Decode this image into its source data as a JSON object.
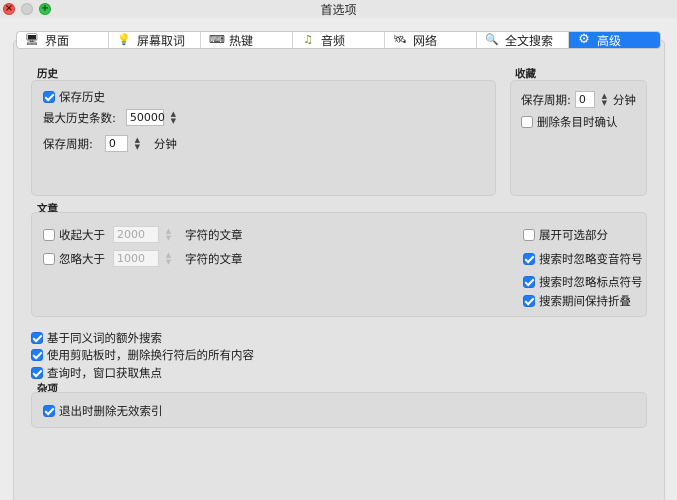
{
  "window": {
    "title": "首选项"
  },
  "titlebar_buttons": {
    "close_glyph": "×",
    "max_glyph": "+"
  },
  "tabs": [
    {
      "label": "界面",
      "icon": "monitor-icon",
      "glyph": "🖥"
    },
    {
      "label": "屏幕取词",
      "icon": "lightbulb-icon",
      "glyph": "💡"
    },
    {
      "label": "热键",
      "icon": "keyboard-icon",
      "glyph": "⌨"
    },
    {
      "label": "音频",
      "icon": "music-note-icon",
      "glyph": "♫"
    },
    {
      "label": "网络",
      "icon": "network-icon",
      "glyph": "🛰"
    },
    {
      "label": "全文搜索",
      "icon": "search-icon",
      "glyph": "🔍"
    },
    {
      "label": "高级",
      "icon": "gear-icon",
      "glyph": "⚙"
    }
  ],
  "active_tab": "高级",
  "history": {
    "title": "历史",
    "save_history_label": "保存历史",
    "save_history_checked": true,
    "max_items_label": "最大历史条数:",
    "max_items_value": "50000",
    "save_period_label": "保存周期:",
    "save_period_value": "0",
    "save_period_unit": "分钟"
  },
  "favorites": {
    "title": "收藏",
    "save_period_label": "保存周期:",
    "save_period_value": "0",
    "save_period_unit": "分钟",
    "confirm_delete_label": "删除条目时确认",
    "confirm_delete_checked": false
  },
  "articles": {
    "title": "文章",
    "collapse_label": "收起大于",
    "collapse_value": "2000",
    "collapse_suffix": "字符的文章",
    "collapse_checked": false,
    "ignore_label": "忽略大于",
    "ignore_value": "1000",
    "ignore_suffix": "字符的文章",
    "ignore_checked": false,
    "expand_optional_label": "展开可选部分",
    "expand_optional_checked": false,
    "ignore_diacritics_label": "搜索时忽略变音符号",
    "ignore_diacritics_checked": true,
    "ignore_punctuation_label": "搜索时忽略标点符号",
    "ignore_punctuation_checked": true,
    "keep_folded_label": "搜索期间保持折叠",
    "keep_folded_checked": true
  },
  "options": [
    {
      "label": "基于同义词的额外搜索",
      "checked": true
    },
    {
      "label": "使用剪贴板时，删除换行符后的所有内容",
      "checked": true
    },
    {
      "label": "查询时，窗口获取焦点",
      "checked": true
    }
  ],
  "misc": {
    "title": "杂项",
    "remove_invalid_index_label": "退出时删除无效索引",
    "remove_invalid_index_checked": true
  },
  "colors": {
    "accent": "#1f7cf3",
    "group_bg": "#dcdcdc",
    "panel_bg": "#e3e3e3"
  }
}
